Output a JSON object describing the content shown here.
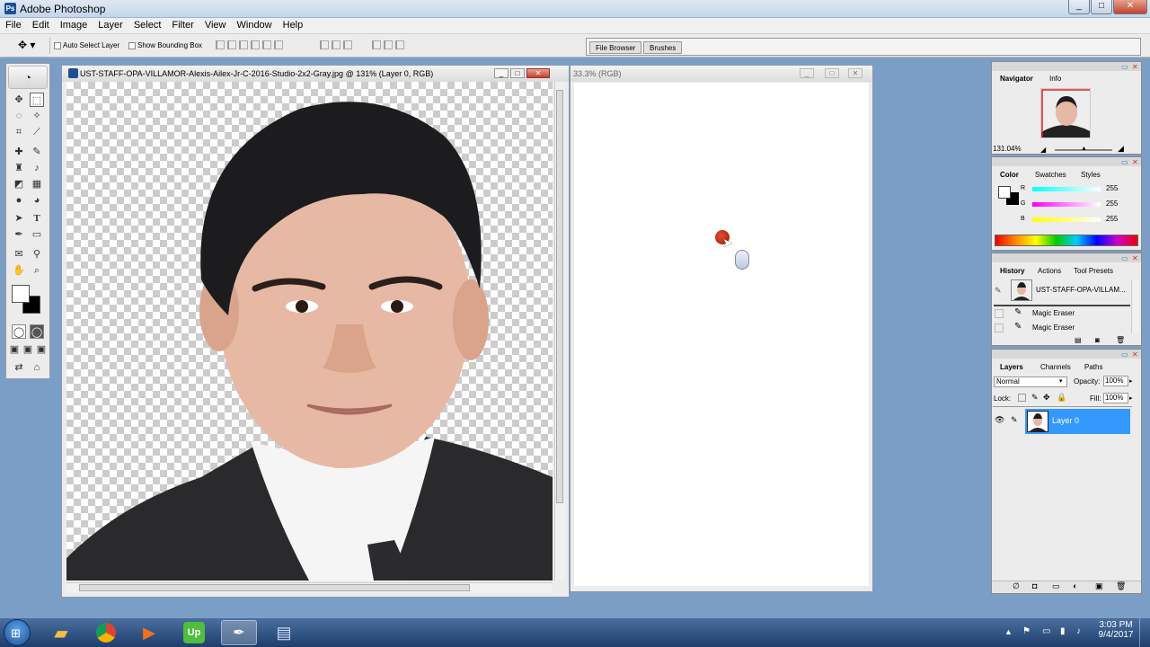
{
  "app": {
    "title": "Adobe Photoshop"
  },
  "window_controls": [
    "_",
    "□",
    "✕"
  ],
  "menu": [
    "File",
    "Edit",
    "Image",
    "Layer",
    "Select",
    "Filter",
    "View",
    "Window",
    "Help"
  ],
  "options": {
    "auto_select_layer": "Auto Select Layer",
    "show_bounding_box": "Show Bounding Box"
  },
  "palette_well": {
    "tabs": [
      "File Browser",
      "Brushes"
    ]
  },
  "doc1": {
    "title": "UST-STAFF-OPA-VILLAMOR-Alexis-Ailex-Jr-C-2016-Studio-2x2-Gray.jpg @ 131% (Layer 0, RGB)"
  },
  "doc2": {
    "title": "33.3% (RGB)"
  },
  "navigator": {
    "tabs": [
      "Navigator",
      "Info"
    ],
    "zoom": "131.04%"
  },
  "color": {
    "tabs": [
      "Color",
      "Swatches",
      "Styles"
    ],
    "channels": [
      {
        "label": "R",
        "value": "255"
      },
      {
        "label": "G",
        "value": "255"
      },
      {
        "label": "B",
        "value": "255"
      }
    ]
  },
  "history": {
    "tabs": [
      "History",
      "Actions",
      "Tool Presets"
    ],
    "snapshot": "UST-STAFF-OPA-VILLAM...",
    "items": [
      "Magic Eraser",
      "Magic Eraser"
    ]
  },
  "layers": {
    "tabs": [
      "Layers",
      "Channels",
      "Paths"
    ],
    "blend_mode": "Normal",
    "opacity_label": "Opacity:",
    "opacity": "100%",
    "lock_label": "Lock:",
    "fill_label": "Fill:",
    "fill": "100%",
    "layer_name": "Layer 0"
  },
  "taskbar": {
    "time": "3:03 PM",
    "date": "9/4/2017"
  },
  "colors": {
    "accent": "#3399ff",
    "workspace": "#7b9ec6"
  }
}
